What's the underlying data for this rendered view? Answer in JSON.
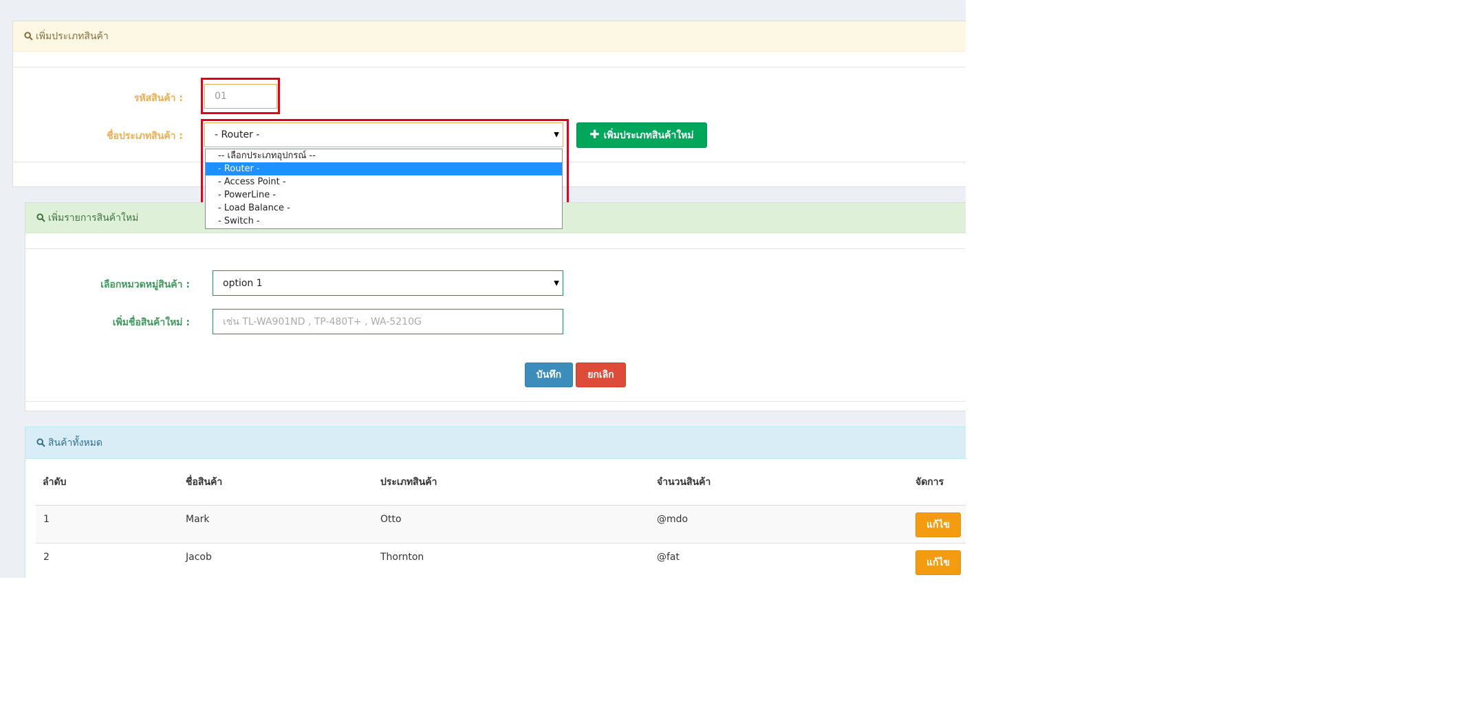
{
  "colors": {
    "panel_warning": "#fcf8e3",
    "panel_success": "#dff0d8",
    "panel_info": "#d9edf7",
    "highlight": "#e3001b",
    "selected_option": "#1e90ff"
  },
  "category_panel": {
    "title": "เพิ่มประเภทสินค้า",
    "code_label": "รหัสสินค้า :",
    "code_value": "01",
    "name_label": "ชื่อประเภทสินค้า :",
    "name_selected": "- Router -",
    "options": [
      "-- เลือกประเภทอุปกรณ์ --",
      "- Router -",
      "- Access Point -",
      "- PowerLine -",
      "- Load Balance -",
      "- Switch -"
    ],
    "selected_index": 1,
    "add_button": "เพิ่มประเภทสินค้าใหม่"
  },
  "product_panel": {
    "title": "เพิ่มรายการสินค้าใหม่",
    "group_label": "เลือกหมวดหมู่สินค้า :",
    "group_value": "option 1",
    "name_label": "เพิ่มชื่อสินค้าใหม่ :",
    "name_placeholder": "เช่น TL-WA901ND , TP-480T+ , WA-5210G",
    "save_button": "บันทึก",
    "cancel_button": "ยกเลิก"
  },
  "list_panel": {
    "title": "สินค้าทั้งหมด",
    "columns": [
      "ลำดับ",
      "ชื่อสินค้า",
      "ประเภทสินค้า",
      "จำนวนสินค้า",
      "จัดการ"
    ],
    "rows": [
      {
        "no": "1",
        "name": "Mark",
        "type": "Otto",
        "qty": "@mdo",
        "action": "แก้ไข"
      },
      {
        "no": "2",
        "name": "Jacob",
        "type": "Thornton",
        "qty": "@fat",
        "action": "แก้ไข"
      }
    ]
  }
}
